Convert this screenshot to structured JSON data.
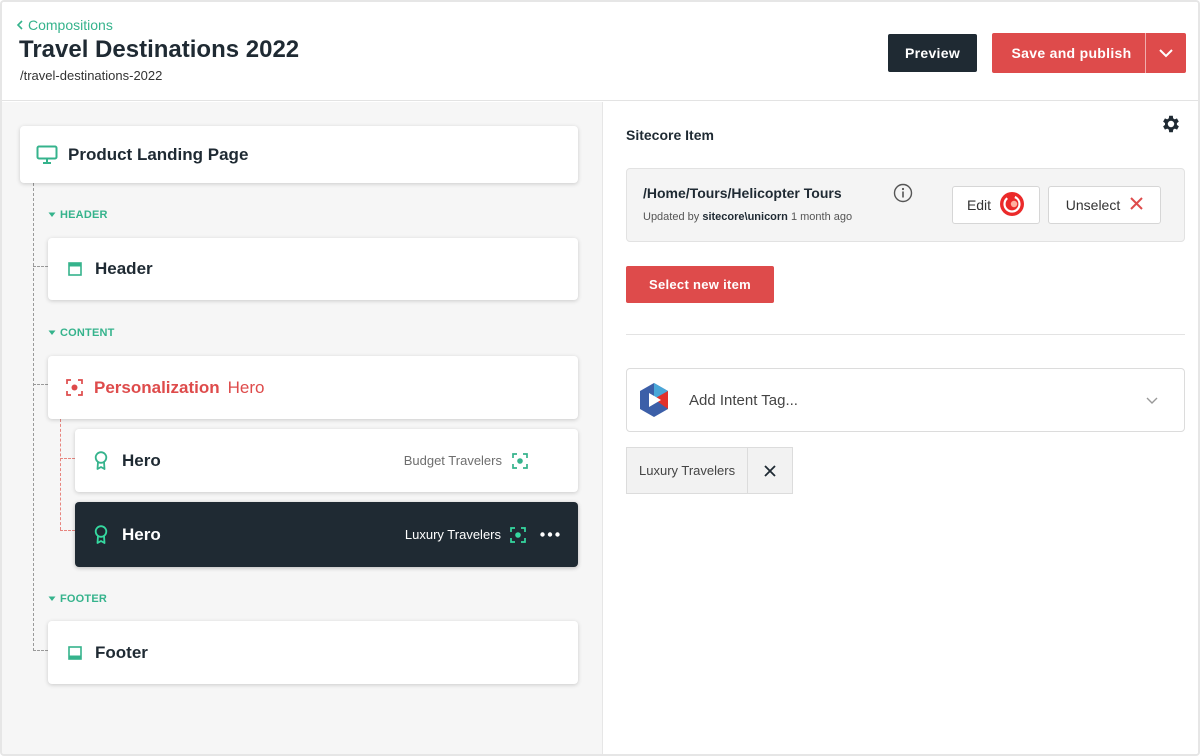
{
  "header": {
    "breadcrumb": "Compositions",
    "title": "Travel Destinations 2022",
    "slug": "/travel-destinations-2022",
    "preview_label": "Preview",
    "publish_label": "Save and publish"
  },
  "tree": {
    "root": {
      "title": "Product Landing Page"
    },
    "sections": {
      "header": "HEADER",
      "content": "CONTENT",
      "footer": "FOOTER"
    },
    "header_item": {
      "title": "Header"
    },
    "personalization": {
      "title": "Personalization",
      "component": "Hero"
    },
    "variants": [
      {
        "title": "Hero",
        "audience": "Budget Travelers",
        "selected": false
      },
      {
        "title": "Hero",
        "audience": "Luxury Travelers",
        "selected": true
      }
    ],
    "footer_item": {
      "title": "Footer"
    }
  },
  "sitecore": {
    "title": "Sitecore Item",
    "item_path": "/Home/Tours/Helicopter Tours",
    "updated_prefix": "Updated by",
    "updated_by": "sitecore\\unicorn",
    "updated_when": "1 month ago",
    "edit_label": "Edit",
    "unselect_label": "Unselect",
    "select_new_label": "Select new item",
    "intent_placeholder": "Add Intent Tag...",
    "tags": [
      "Luxury Travelers"
    ]
  },
  "colors": {
    "accent_green": "#35b38c",
    "accent_red": "#de4b4b",
    "dark": "#1f2a33"
  },
  "icons": {
    "breadcrumb": "chevron-left-icon",
    "root": "monitor-icon",
    "header": "header-block-icon",
    "personalization": "personalization-target-icon",
    "variant": "award-ribbon-icon",
    "audience": "audience-target-icon",
    "footer": "footer-block-icon",
    "gear": "gear-icon",
    "info": "info-icon",
    "edit": "sitecore-logo-icon",
    "unselect": "close-icon",
    "intent": "intent-logo-icon",
    "dropdown": "chevron-down-icon"
  }
}
